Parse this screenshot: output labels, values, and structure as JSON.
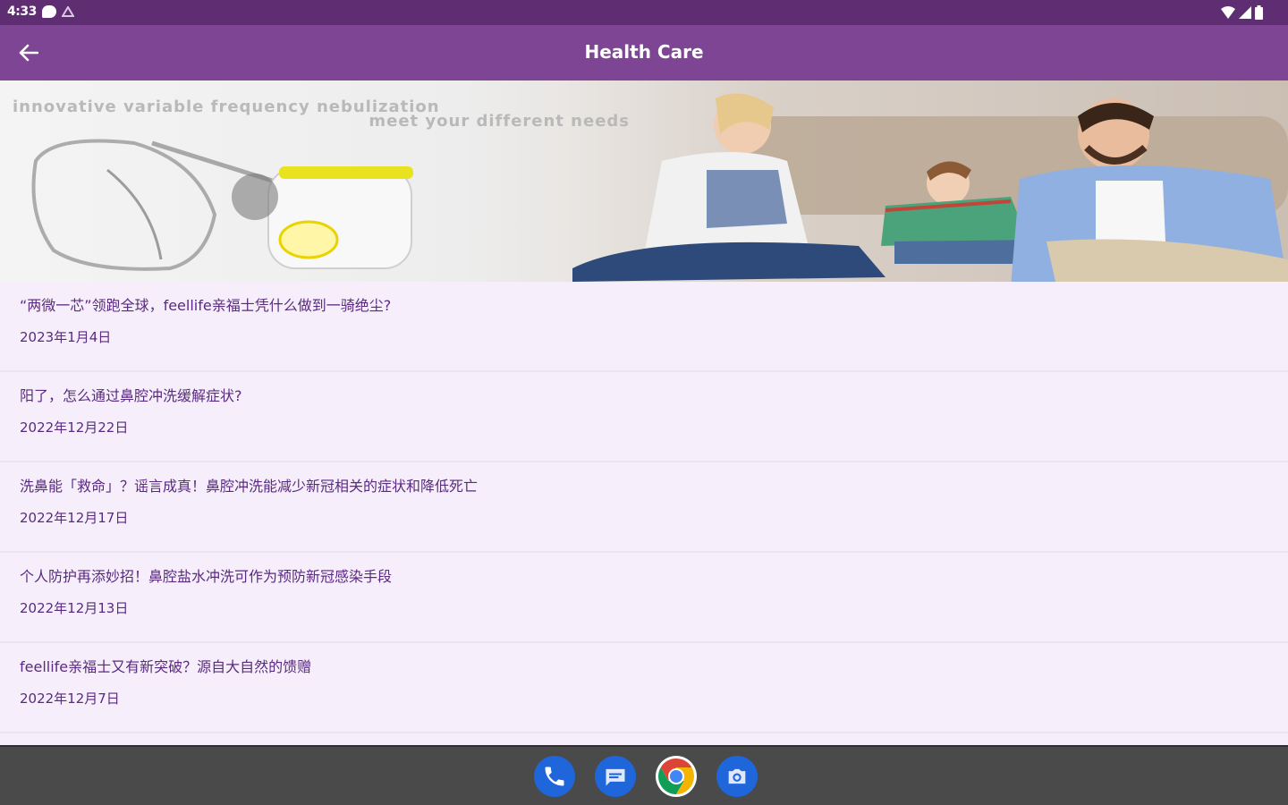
{
  "status_bar": {
    "time": "4:33"
  },
  "app_bar": {
    "title": "Health Care"
  },
  "banner": {
    "tagline_line1": "innovative variable frequency nebulization",
    "tagline_line2": "meet your different needs"
  },
  "news": [
    {
      "title": "“两微一芯”领跑全球，feellife亲福士凭什么做到一骑绝尘?",
      "date": "2023年1月4日"
    },
    {
      "title": "阳了，怎么通过鼻腔冲洗缓解症状?",
      "date": "2022年12月22日"
    },
    {
      "title": "洗鼻能「救命」？谣言成真！鼻腔冲洗能减少新冠相关的症状和降低死亡",
      "date": "2022年12月17日"
    },
    {
      "title": "个人防护再添妙招！鼻腔盐水冲洗可作为预防新冠感染手段",
      "date": "2022年12月13日"
    },
    {
      "title": "feellife亲福士又有新突破？源自大自然的馈赠",
      "date": "2022年12月7日"
    }
  ],
  "colors": {
    "status_bar": "#5f2d72",
    "app_bar": "#7f4595",
    "list_bg": "#f6effb",
    "text": "#5a2a80",
    "dot_active": "#1565c0"
  },
  "dock": {
    "apps": [
      "phone-icon",
      "messages-icon",
      "chrome-icon",
      "camera-icon"
    ]
  }
}
